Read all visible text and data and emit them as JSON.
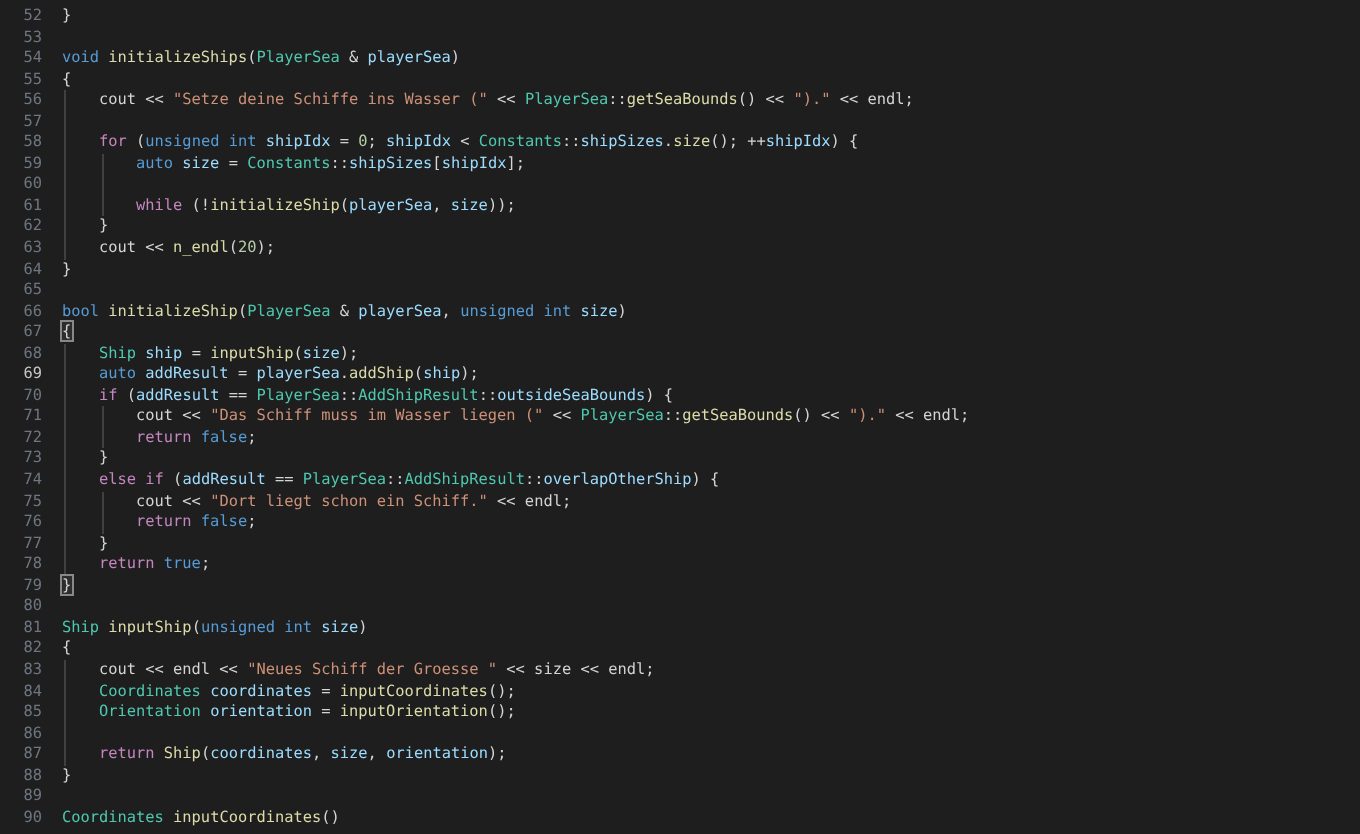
{
  "editor": {
    "lines": [
      {
        "number": "52",
        "current": false,
        "tokens": [
          {
            "text": "}",
            "kind": "plain"
          }
        ]
      },
      {
        "number": "53",
        "current": false
      },
      {
        "number": "54",
        "current": false,
        "tokens": [
          {
            "text": "void",
            "kind": "kw"
          },
          {
            "text": " initializeShips",
            "kind": "fn"
          },
          {
            "text": "(",
            "kind": "plain"
          },
          {
            "text": "PlayerSea",
            "kind": "type"
          },
          {
            "text": " & ",
            "kind": "plain"
          },
          {
            "text": "playerSea",
            "kind": "var"
          },
          {
            "text": ")",
            "kind": "plain"
          }
        ]
      },
      {
        "number": "55",
        "current": false,
        "tokens": [
          {
            "text": "{",
            "kind": "plain"
          }
        ]
      },
      {
        "number": "56",
        "current": false,
        "tokens": [
          {
            "text": "    cout << ",
            "kind": "plain"
          },
          {
            "text": "\"Setze deine Schiffe ins Wasser (\"",
            "kind": "str"
          },
          {
            "text": " << ",
            "kind": "plain"
          },
          {
            "text": "PlayerSea",
            "kind": "type"
          },
          {
            "text": "::",
            "kind": "plain"
          },
          {
            "text": "getSeaBounds",
            "kind": "fn"
          },
          {
            "text": "() << ",
            "kind": "plain"
          },
          {
            "text": "\").\"",
            "kind": "str"
          },
          {
            "text": " << endl;",
            "kind": "plain"
          }
        ]
      },
      {
        "number": "57",
        "current": false
      },
      {
        "number": "58",
        "current": false,
        "tokens": [
          {
            "text": "    for",
            "kind": "ctl"
          },
          {
            "text": " (",
            "kind": "plain"
          },
          {
            "text": "unsigned int",
            "kind": "kw"
          },
          {
            "text": " shipIdx",
            "kind": "var"
          },
          {
            "text": " = ",
            "kind": "plain"
          },
          {
            "text": "0",
            "kind": "num"
          },
          {
            "text": "; ",
            "kind": "plain"
          },
          {
            "text": "shipIdx",
            "kind": "var"
          },
          {
            "text": " < ",
            "kind": "plain"
          },
          {
            "text": "Constants",
            "kind": "type"
          },
          {
            "text": "::",
            "kind": "plain"
          },
          {
            "text": "shipSizes",
            "kind": "var"
          },
          {
            "text": ".",
            "kind": "plain"
          },
          {
            "text": "size",
            "kind": "fn"
          },
          {
            "text": "(); ++",
            "kind": "plain"
          },
          {
            "text": "shipIdx",
            "kind": "var"
          },
          {
            "text": ") {",
            "kind": "plain"
          }
        ]
      },
      {
        "number": "59",
        "current": false,
        "tokens": [
          {
            "text": "        auto",
            "kind": "kw"
          },
          {
            "text": " size",
            "kind": "var"
          },
          {
            "text": " = ",
            "kind": "plain"
          },
          {
            "text": "Constants",
            "kind": "type"
          },
          {
            "text": "::",
            "kind": "plain"
          },
          {
            "text": "shipSizes",
            "kind": "var"
          },
          {
            "text": "[",
            "kind": "plain"
          },
          {
            "text": "shipIdx",
            "kind": "var"
          },
          {
            "text": "];",
            "kind": "plain"
          }
        ]
      },
      {
        "number": "60",
        "current": false
      },
      {
        "number": "61",
        "current": false,
        "tokens": [
          {
            "text": "        while",
            "kind": "ctl"
          },
          {
            "text": " (!",
            "kind": "plain"
          },
          {
            "text": "initializeShip",
            "kind": "fn"
          },
          {
            "text": "(",
            "kind": "plain"
          },
          {
            "text": "playerSea",
            "kind": "var"
          },
          {
            "text": ", ",
            "kind": "plain"
          },
          {
            "text": "size",
            "kind": "var"
          },
          {
            "text": "));",
            "kind": "plain"
          }
        ]
      },
      {
        "number": "62",
        "current": false,
        "tokens": [
          {
            "text": "    }",
            "kind": "plain"
          }
        ]
      },
      {
        "number": "63",
        "current": false,
        "tokens": [
          {
            "text": "    cout << ",
            "kind": "plain"
          },
          {
            "text": "n_endl",
            "kind": "fn"
          },
          {
            "text": "(",
            "kind": "plain"
          },
          {
            "text": "20",
            "kind": "num"
          },
          {
            "text": ");",
            "kind": "plain"
          }
        ]
      },
      {
        "number": "64",
        "current": false,
        "tokens": [
          {
            "text": "}",
            "kind": "plain"
          }
        ]
      },
      {
        "number": "65",
        "current": false
      },
      {
        "number": "66",
        "current": false,
        "tokens": [
          {
            "text": "bool",
            "kind": "kw"
          },
          {
            "text": " initializeShip",
            "kind": "fn"
          },
          {
            "text": "(",
            "kind": "plain"
          },
          {
            "text": "PlayerSea",
            "kind": "type"
          },
          {
            "text": " & ",
            "kind": "plain"
          },
          {
            "text": "playerSea",
            "kind": "var"
          },
          {
            "text": ", ",
            "kind": "plain"
          },
          {
            "text": "unsigned int",
            "kind": "kw"
          },
          {
            "text": " size",
            "kind": "var"
          },
          {
            "text": ")",
            "kind": "plain"
          }
        ]
      },
      {
        "number": "67",
        "current": false,
        "tokens": [
          {
            "text": "{",
            "kind": "match"
          }
        ]
      },
      {
        "number": "68",
        "current": false,
        "tokens": [
          {
            "text": "    Ship",
            "kind": "type"
          },
          {
            "text": " ship",
            "kind": "var"
          },
          {
            "text": " = ",
            "kind": "plain"
          },
          {
            "text": "inputShip",
            "kind": "fn"
          },
          {
            "text": "(",
            "kind": "plain"
          },
          {
            "text": "size",
            "kind": "var"
          },
          {
            "text": ");",
            "kind": "plain"
          }
        ]
      },
      {
        "number": "69",
        "current": true,
        "tokens": [
          {
            "text": "    auto",
            "kind": "kw"
          },
          {
            "text": " addResult",
            "kind": "var"
          },
          {
            "text": " = ",
            "kind": "plain"
          },
          {
            "text": "playerSea",
            "kind": "var"
          },
          {
            "text": ".",
            "kind": "plain"
          },
          {
            "text": "addShip",
            "kind": "fn"
          },
          {
            "text": "(",
            "kind": "plain"
          },
          {
            "text": "ship",
            "kind": "var"
          },
          {
            "text": ");",
            "kind": "plain"
          }
        ]
      },
      {
        "number": "70",
        "current": false,
        "tokens": [
          {
            "text": "    if",
            "kind": "ctl"
          },
          {
            "text": " (",
            "kind": "plain"
          },
          {
            "text": "addResult",
            "kind": "var"
          },
          {
            "text": " == ",
            "kind": "plain"
          },
          {
            "text": "PlayerSea",
            "kind": "type"
          },
          {
            "text": "::",
            "kind": "plain"
          },
          {
            "text": "AddShipResult",
            "kind": "type"
          },
          {
            "text": "::",
            "kind": "plain"
          },
          {
            "text": "outsideSeaBounds",
            "kind": "var"
          },
          {
            "text": ") {",
            "kind": "plain"
          }
        ]
      },
      {
        "number": "71",
        "current": false,
        "tokens": [
          {
            "text": "        cout << ",
            "kind": "plain"
          },
          {
            "text": "\"Das Schiff muss im Wasser liegen (\"",
            "kind": "str"
          },
          {
            "text": " << ",
            "kind": "plain"
          },
          {
            "text": "PlayerSea",
            "kind": "type"
          },
          {
            "text": "::",
            "kind": "plain"
          },
          {
            "text": "getSeaBounds",
            "kind": "fn"
          },
          {
            "text": "() << ",
            "kind": "plain"
          },
          {
            "text": "\").\"",
            "kind": "str"
          },
          {
            "text": " << endl;",
            "kind": "plain"
          }
        ]
      },
      {
        "number": "72",
        "current": false,
        "tokens": [
          {
            "text": "        return",
            "kind": "ctl"
          },
          {
            "text": " false",
            "kind": "kw"
          },
          {
            "text": ";",
            "kind": "plain"
          }
        ]
      },
      {
        "number": "73",
        "current": false,
        "tokens": [
          {
            "text": "    }",
            "kind": "plain"
          }
        ]
      },
      {
        "number": "74",
        "current": false,
        "tokens": [
          {
            "text": "    else if",
            "kind": "ctl"
          },
          {
            "text": " (",
            "kind": "plain"
          },
          {
            "text": "addResult",
            "kind": "var"
          },
          {
            "text": " == ",
            "kind": "plain"
          },
          {
            "text": "PlayerSea",
            "kind": "type"
          },
          {
            "text": "::",
            "kind": "plain"
          },
          {
            "text": "AddShipResult",
            "kind": "type"
          },
          {
            "text": "::",
            "kind": "plain"
          },
          {
            "text": "overlapOtherShip",
            "kind": "var"
          },
          {
            "text": ") {",
            "kind": "plain"
          }
        ]
      },
      {
        "number": "75",
        "current": false,
        "tokens": [
          {
            "text": "        cout << ",
            "kind": "plain"
          },
          {
            "text": "\"Dort liegt schon ein Schiff.\"",
            "kind": "str"
          },
          {
            "text": " << endl;",
            "kind": "plain"
          }
        ]
      },
      {
        "number": "76",
        "current": false,
        "tokens": [
          {
            "text": "        return",
            "kind": "ctl"
          },
          {
            "text": " false",
            "kind": "kw"
          },
          {
            "text": ";",
            "kind": "plain"
          }
        ]
      },
      {
        "number": "77",
        "current": false,
        "tokens": [
          {
            "text": "    }",
            "kind": "plain"
          }
        ]
      },
      {
        "number": "78",
        "current": false,
        "tokens": [
          {
            "text": "    return",
            "kind": "ctl"
          },
          {
            "text": " true",
            "kind": "kw"
          },
          {
            "text": ";",
            "kind": "plain"
          }
        ]
      },
      {
        "number": "79",
        "current": false,
        "tokens": [
          {
            "text": "}",
            "kind": "match"
          }
        ]
      },
      {
        "number": "80",
        "current": false
      },
      {
        "number": "81",
        "current": false,
        "tokens": [
          {
            "text": "Ship",
            "kind": "type"
          },
          {
            "text": " inputShip",
            "kind": "fn"
          },
          {
            "text": "(",
            "kind": "plain"
          },
          {
            "text": "unsigned int",
            "kind": "kw"
          },
          {
            "text": " size",
            "kind": "var"
          },
          {
            "text": ")",
            "kind": "plain"
          }
        ]
      },
      {
        "number": "82",
        "current": false,
        "tokens": [
          {
            "text": "{",
            "kind": "plain"
          }
        ]
      },
      {
        "number": "83",
        "current": false,
        "tokens": [
          {
            "text": "    cout << endl << ",
            "kind": "plain"
          },
          {
            "text": "\"Neues Schiff der Groesse \"",
            "kind": "str"
          },
          {
            "text": " << size << endl;",
            "kind": "plain"
          }
        ]
      },
      {
        "number": "84",
        "current": false,
        "tokens": [
          {
            "text": "    Coordinates",
            "kind": "type"
          },
          {
            "text": " coordinates",
            "kind": "var"
          },
          {
            "text": " = ",
            "kind": "plain"
          },
          {
            "text": "inputCoordinates",
            "kind": "fn"
          },
          {
            "text": "();",
            "kind": "plain"
          }
        ]
      },
      {
        "number": "85",
        "current": false,
        "tokens": [
          {
            "text": "    Orientation",
            "kind": "type"
          },
          {
            "text": " orientation",
            "kind": "var"
          },
          {
            "text": " = ",
            "kind": "plain"
          },
          {
            "text": "inputOrientation",
            "kind": "fn"
          },
          {
            "text": "();",
            "kind": "plain"
          }
        ]
      },
      {
        "number": "86",
        "current": false
      },
      {
        "number": "87",
        "current": false,
        "tokens": [
          {
            "text": "    return",
            "kind": "ctl"
          },
          {
            "text": " Ship",
            "kind": "fn"
          },
          {
            "text": "(",
            "kind": "plain"
          },
          {
            "text": "coordinates",
            "kind": "var"
          },
          {
            "text": ", ",
            "kind": "plain"
          },
          {
            "text": "size",
            "kind": "var"
          },
          {
            "text": ", ",
            "kind": "plain"
          },
          {
            "text": "orientation",
            "kind": "var"
          },
          {
            "text": ");",
            "kind": "plain"
          }
        ]
      },
      {
        "number": "88",
        "current": false,
        "tokens": [
          {
            "text": "}",
            "kind": "plain"
          }
        ]
      },
      {
        "number": "89",
        "current": false
      },
      {
        "number": "90",
        "current": false,
        "tokens": [
          {
            "text": "Coordinates",
            "kind": "type"
          },
          {
            "text": " inputCoordinates",
            "kind": "fn"
          },
          {
            "text": "()",
            "kind": "plain"
          }
        ]
      }
    ]
  }
}
